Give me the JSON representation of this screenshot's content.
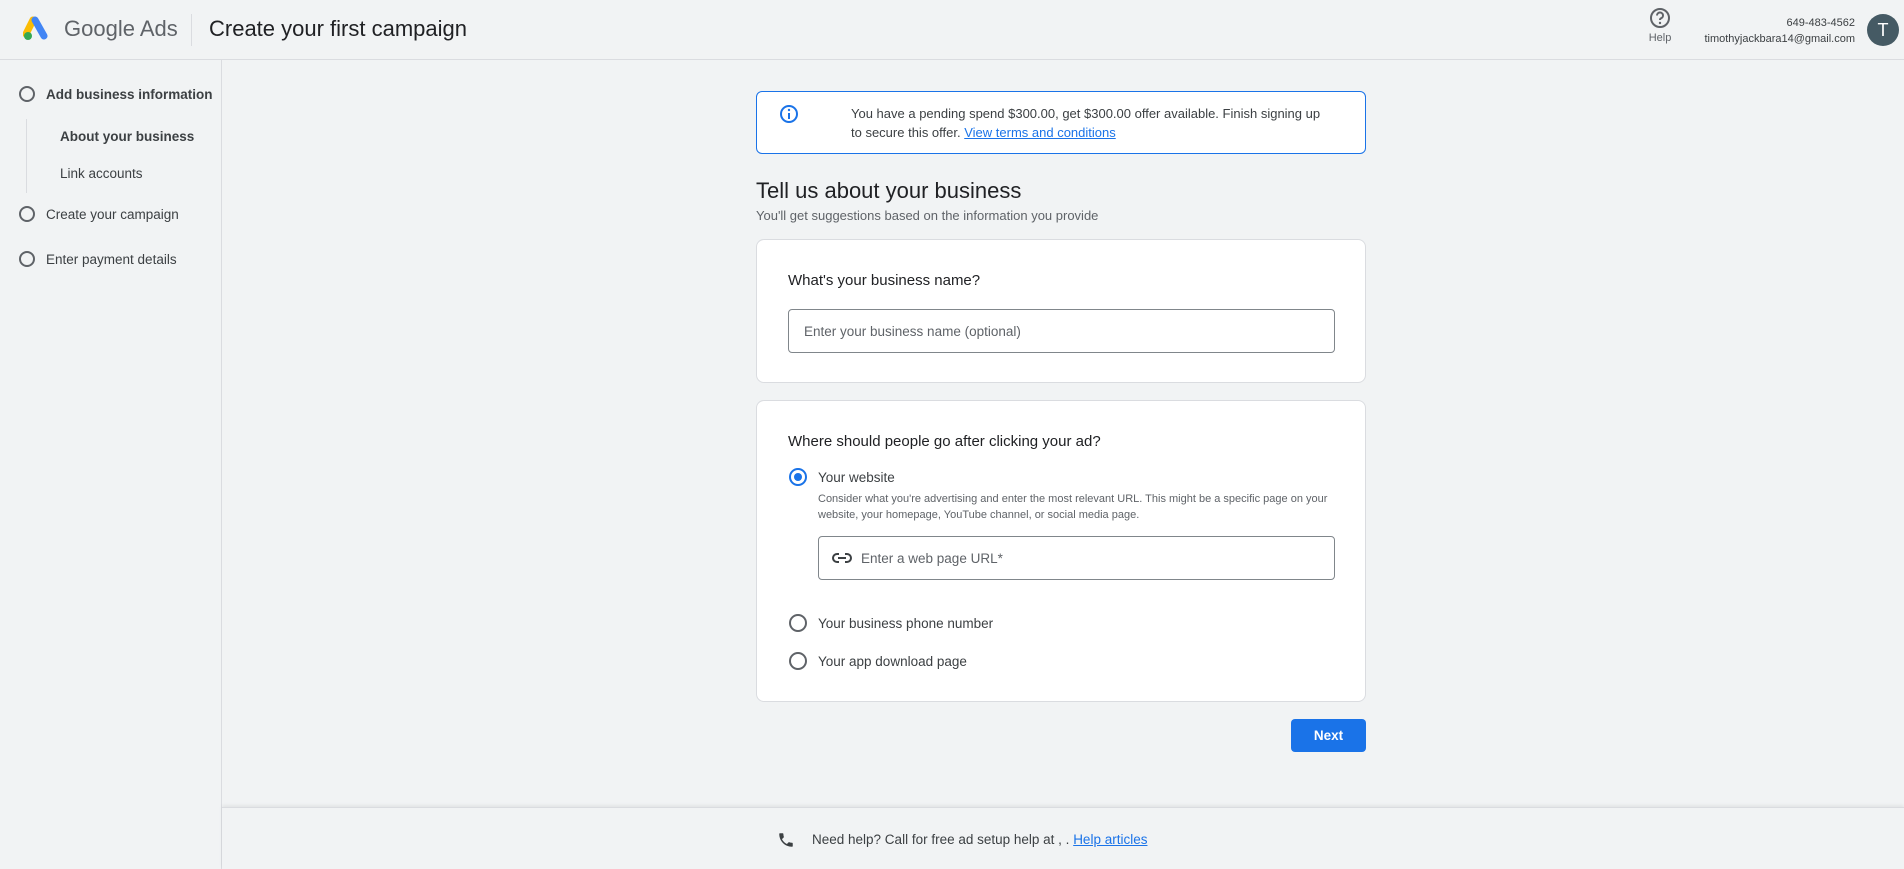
{
  "header": {
    "brand": "Google Ads",
    "title": "Create your first campaign",
    "help_label": "Help",
    "phone": "649-483-4562",
    "email": "timothyjackbara14@gmail.com",
    "avatar_initial": "T"
  },
  "sidebar": {
    "steps": [
      {
        "label": "Add business information",
        "substeps": [
          "About your business",
          "Link accounts"
        ]
      },
      {
        "label": "Create your campaign"
      },
      {
        "label": "Enter payment details"
      }
    ]
  },
  "banner": {
    "text": "You have a pending spend $300.00, get $300.00 offer available. Finish signing up to secure this offer.",
    "link": "View terms and conditions"
  },
  "main": {
    "title": "Tell us about your business",
    "subtitle": "You'll get suggestions based on the information you provide",
    "business_name": {
      "heading": "What's your business name?",
      "placeholder": "Enter your business name (optional)",
      "value": ""
    },
    "destination": {
      "heading": "Where should people go after clicking your ad?",
      "options": [
        {
          "label": "Your website",
          "selected": true,
          "description": "Consider what you're advertising and enter the most relevant URL. This might be a specific page on your website, your homepage, YouTube channel, or social media page.",
          "url_placeholder": "Enter a web page URL*"
        },
        {
          "label": "Your business phone number",
          "selected": false
        },
        {
          "label": "Your app download page",
          "selected": false
        }
      ]
    },
    "next_label": "Next"
  },
  "footer": {
    "text": "Need help? Call for free ad setup help at , .",
    "link": "Help articles"
  },
  "colors": {
    "accent": "#1a73e8",
    "background": "#f1f3f4"
  }
}
